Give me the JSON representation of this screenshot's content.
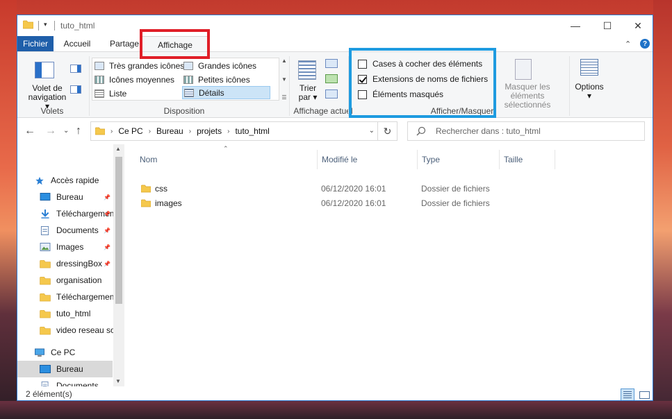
{
  "window": {
    "title": "tuto_html",
    "controls": {
      "minimize": "—",
      "maximize": "☐",
      "close": "✕"
    }
  },
  "tabs": [
    {
      "label": "Fichier"
    },
    {
      "label": "Accueil"
    },
    {
      "label": "Partage"
    },
    {
      "label": "Affichage"
    }
  ],
  "ribbon": {
    "volets": {
      "button_line1": "Volet de",
      "button_line2": "navigation",
      "group_label": "Volets"
    },
    "disposition": {
      "items": [
        "Très grandes icônes",
        "Grandes icônes",
        "Icônes moyennes",
        "Petites icônes",
        "Liste",
        "Détails"
      ],
      "selected": "Détails",
      "group_label": "Disposition"
    },
    "affichage_actuel": {
      "sort_line1": "Trier",
      "sort_line2": "par",
      "group_label": "Affichage actuel"
    },
    "afficher_masquer": {
      "checkboxes": [
        {
          "label": "Cases à cocher des éléments",
          "checked": false
        },
        {
          "label": "Extensions de noms de fichiers",
          "checked": true
        },
        {
          "label": "Éléments masqués",
          "checked": false
        }
      ],
      "hide_selected_line1": "Masquer les éléments",
      "hide_selected_line2": "sélectionnés",
      "group_label": "Afficher/Masquer"
    },
    "options": {
      "label": "Options"
    }
  },
  "address": {
    "crumbs": [
      "Ce PC",
      "Bureau",
      "projets",
      "tuto_html"
    ]
  },
  "search": {
    "placeholder": "Rechercher dans : tuto_html"
  },
  "navpane": {
    "quick_access": "Accès rapide",
    "items": [
      {
        "label": "Bureau",
        "pinned": true,
        "icon": "desktop-icon"
      },
      {
        "label": "Téléchargements",
        "pinned": true,
        "icon": "download-icon"
      },
      {
        "label": "Documents",
        "pinned": true,
        "icon": "documents-icon"
      },
      {
        "label": "Images",
        "pinned": true,
        "icon": "images-icon"
      },
      {
        "label": "dressingBox",
        "pinned": true,
        "icon": "folder-icon"
      },
      {
        "label": "organisation",
        "pinned": false,
        "icon": "folder-icon"
      },
      {
        "label": "Téléchargement",
        "pinned": false,
        "icon": "folder-icon"
      },
      {
        "label": "tuto_html",
        "pinned": false,
        "icon": "folder-icon"
      },
      {
        "label": "video reseau soc",
        "pinned": false,
        "icon": "folder-icon"
      }
    ],
    "this_pc": "Ce PC",
    "pc_items": [
      {
        "label": "Bureau",
        "selected": true
      },
      {
        "label": "Documents",
        "selected": false
      }
    ]
  },
  "files": {
    "columns": [
      "Nom",
      "Modifié le",
      "Type",
      "Taille"
    ],
    "rows": [
      {
        "name": "css",
        "modified": "06/12/2020 16:01",
        "type": "Dossier de fichiers",
        "size": ""
      },
      {
        "name": "images",
        "modified": "06/12/2020 16:01",
        "type": "Dossier de fichiers",
        "size": ""
      }
    ]
  },
  "status": {
    "text": "2 élément(s)"
  },
  "colors": {
    "accent": "#1f5faa",
    "highlight_red": "#e01e27",
    "highlight_blue": "#1e9be0",
    "folder": "#f5c84c"
  }
}
